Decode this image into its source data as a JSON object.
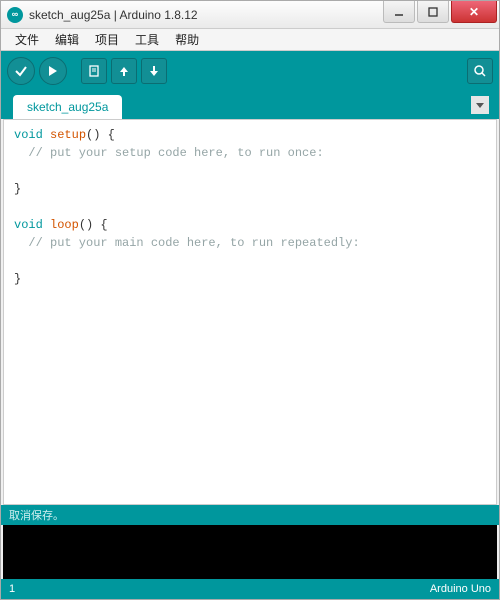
{
  "window": {
    "title": "sketch_aug25a | Arduino 1.8.12",
    "app_icon_text": "∞"
  },
  "menu": {
    "file": "文件",
    "edit": "编辑",
    "project": "项目",
    "tools": "工具",
    "help": "帮助"
  },
  "tab": {
    "name": "sketch_aug25a"
  },
  "code": {
    "kw1": "void",
    "fn1": "setup",
    "open1": "() {",
    "cm1": "  // put your setup code here, to run once:",
    "close1": "}",
    "kw2": "void",
    "fn2": "loop",
    "open2": "() {",
    "cm2": "  // put your main code here, to run repeatedly:",
    "close2": "}"
  },
  "status": {
    "text": "取消保存。"
  },
  "footer": {
    "line": "1",
    "board": "Arduino Uno"
  }
}
